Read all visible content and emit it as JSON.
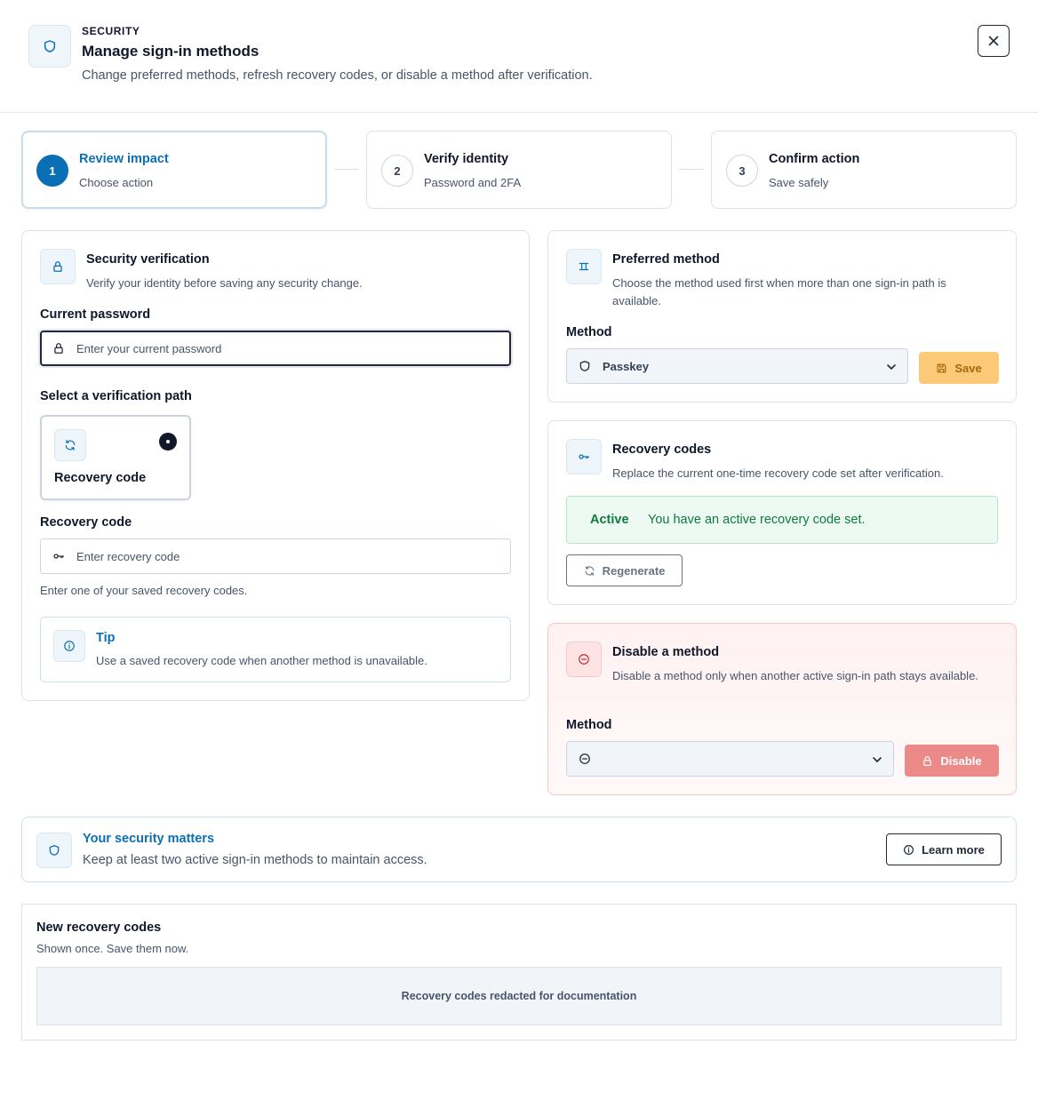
{
  "header": {
    "eyebrow": "SECURITY",
    "title": "Manage sign-in methods",
    "subtitle": "Change preferred methods, refresh recovery codes, or disable a method after verification."
  },
  "steps": [
    {
      "number": "1",
      "title": "Review impact",
      "subtitle": "Choose action",
      "state": "active"
    },
    {
      "number": "2",
      "title": "Verify identity",
      "subtitle": "Password and 2FA",
      "state": "upcoming"
    },
    {
      "number": "3",
      "title": "Confirm action",
      "subtitle": "Save safely",
      "state": "upcoming"
    }
  ],
  "verification": {
    "title": "Security verification",
    "subtitle": "Verify your identity before saving any security change.",
    "password_label": "Current password",
    "password_placeholder": "Enter your current password",
    "path_label": "Select a verification path",
    "path_option": "Recovery code",
    "recovery_label": "Recovery code",
    "recovery_placeholder": "Enter recovery code",
    "recovery_help": "Enter one of your saved recovery codes.",
    "tip_title": "Tip",
    "tip_text": "Use a saved recovery code when another method is unavailable."
  },
  "preferred": {
    "title": "Preferred method",
    "subtitle": "Choose the method used first when more than one sign-in path is available.",
    "method_label": "Method",
    "method_value": "Passkey",
    "save_label": "Save"
  },
  "recovery_codes": {
    "title": "Recovery codes",
    "subtitle": "Replace the current one-time recovery code set after verification.",
    "status_badge": "Active",
    "status_text": "You have an active recovery code set.",
    "regenerate_label": "Regenerate"
  },
  "disable": {
    "title": "Disable a method",
    "subtitle": "Disable a method only when another active sign-in path stays available.",
    "method_label": "Method",
    "method_value": "",
    "disable_label": "Disable"
  },
  "security_banner": {
    "title": "Your security matters",
    "text": "Keep at least two active sign-in methods to maintain access.",
    "learn_more_label": "Learn more"
  },
  "new_codes": {
    "title": "New recovery codes",
    "subtitle": "Shown once. Save them now.",
    "redacted_text": "Recovery codes redacted for documentation"
  },
  "colors": {
    "accent": "#0b6fb6",
    "save_button": "#fcc979",
    "success_text": "#0f7a3f",
    "danger_button": "#ec8a8a",
    "danger_bg": "#fff3f3"
  }
}
